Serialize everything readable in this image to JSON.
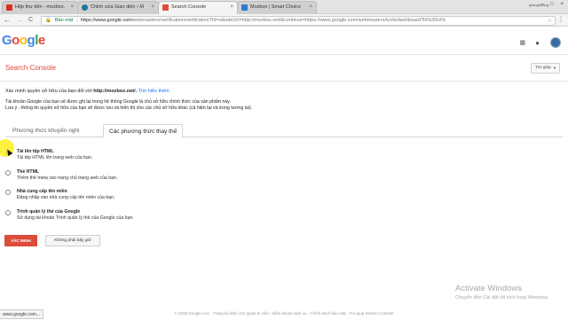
{
  "browser": {
    "tabs": [
      {
        "title": "Hộp thư đến - mozbox.",
        "favicon_color": "#d93025"
      },
      {
        "title": "Chỉnh sửa Giao diện ‹ M",
        "favicon_color": "#21759b"
      },
      {
        "title": "Search Console",
        "favicon_color": "#dd4b39"
      },
      {
        "title": "Mozbox | Smart Choice",
        "favicon_color": "#2b7bd6"
      }
    ],
    "tab_close": "×",
    "user_label": "quanghoang",
    "window_controls": "‒ □ ×",
    "back": "←",
    "forward": "→",
    "reload": "C",
    "secure_label": "Bảo mật",
    "url_host": "https://www.google.com",
    "url_rest": "/webmasters/verification/verification?hl=vi&siteUrl=http://mozbox.net/&continue=https://www.google.com/webmasters/tools/dashboard?hl%3Dvi%",
    "star": "☆",
    "menu": "⋮"
  },
  "google": {
    "logo": [
      "G",
      "o",
      "o",
      "g",
      "l",
      "e"
    ],
    "logo_colors": [
      "#4285f4",
      "#ea4335",
      "#fbbc05",
      "#4285f4",
      "#34a853",
      "#ea4335"
    ],
    "apps": "⋮⋮⋮",
    "bell": "●"
  },
  "search_console": {
    "title": "Search Console",
    "help": "Trợ giúp",
    "help_caret": "▼"
  },
  "verify_intro": {
    "text": "Xác minh quyền sở hữu của bạn đối với",
    "site": "http://mozbox.net/.",
    "link": "Tìm hiểu thêm"
  },
  "info": {
    "line1": "Tài khoản Google của bạn sẽ được ghi lại trong hệ thống Google là chủ sở hữu chính thức của sản phẩm này.",
    "line2": "Lưu ý - thông tin quyền sở hữu của bạn sẽ được lưu và hiển thị cho các chủ sở hữu khác (cả hiện tại và trong tương lai)."
  },
  "method_tabs": {
    "recommended": "Phương thức khuyến nghị",
    "alternate": "Các phương thức thay thế"
  },
  "options": [
    {
      "title": "Tải lên tệp HTML",
      "desc": "Tải tệp HTML lên trang web của bạn.",
      "checked": true
    },
    {
      "title": "Thẻ HTML",
      "desc": "Thêm thẻ meta vào trang chủ trang web của bạn.",
      "checked": false
    },
    {
      "title": "Nhà cung cấp tên miền",
      "desc": "Đăng nhập vào nhà cung cấp tên miền của bạn.",
      "checked": false
    },
    {
      "title": "Trình quản lý thẻ của Google",
      "desc": "Sử dụng tài khoản Trình quản lý thẻ của Google của bạn.",
      "checked": false
    }
  ],
  "buttons": {
    "verify": "XÁC MINH",
    "not_now": "Không phải bây giờ"
  },
  "footer": "© 2018 Google LLC - Trang tài đình cho Quản tri viên - Điều khoản dịch vụ - Chính sách bảo mật - Trợ giúp Search Console",
  "status_bar": "www.google.com...",
  "windows_watermark": {
    "line1": "Activate Windows",
    "line2": "Chuyển đến Cài đặt để kích hoạt Windows."
  }
}
